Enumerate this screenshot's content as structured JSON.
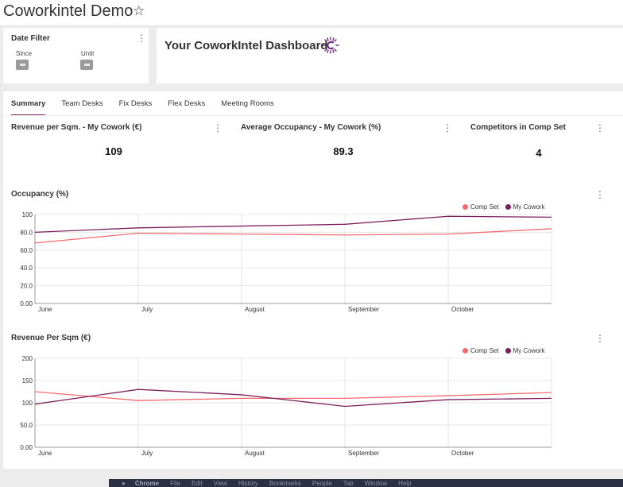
{
  "app": {
    "title": "Coworkintel Demo",
    "favorite_icon": "star-outline-icon"
  },
  "date_filter": {
    "title": "Date Filter",
    "since_label": "Since",
    "until_label": "Until"
  },
  "banner": {
    "title": "Your CoworkIntel Dashboard",
    "logo_icon": "coworkintel-logo-icon"
  },
  "tabs": [
    {
      "label": "Summary",
      "active": true
    },
    {
      "label": "Team Desks",
      "active": false
    },
    {
      "label": "Fix Desks",
      "active": false
    },
    {
      "label": "Flex Desks",
      "active": false
    },
    {
      "label": "Meeting Rooms",
      "active": false
    }
  ],
  "kpis": [
    {
      "title": "Revenue per Sqm. - My Cowork (€)",
      "value": "109"
    },
    {
      "title": "Average Occupancy - My Cowork (%)",
      "value": "89.3"
    },
    {
      "title": "Competitors in Comp Set",
      "value": "4"
    }
  ],
  "colors": {
    "comp_set": "#f36a6f",
    "my_cowork": "#7b1f5c",
    "accent": "#7b2d5c",
    "grid": "#e6e6e6"
  },
  "chart_data": [
    {
      "type": "line",
      "title": "Occupancy (%)",
      "categories": [
        "June",
        "July",
        "August",
        "September",
        "October"
      ],
      "x": [
        0,
        1,
        2,
        3,
        4,
        5
      ],
      "ylim": [
        0,
        100
      ],
      "yticks": [
        "0.00",
        "20.0",
        "40.0",
        "60.0",
        "80.0",
        "100"
      ],
      "legend_position": "top-right",
      "grid": true,
      "series": [
        {
          "name": "Comp Set",
          "values": [
            68,
            79,
            78,
            77,
            78,
            84
          ]
        },
        {
          "name": "My Cowork",
          "values": [
            80,
            85,
            87,
            89,
            98,
            97
          ]
        }
      ]
    },
    {
      "type": "line",
      "title": "Revenue Per Sqm (€)",
      "categories": [
        "June",
        "July",
        "August",
        "September",
        "October"
      ],
      "x": [
        0,
        1,
        2,
        3,
        4,
        5
      ],
      "ylim": [
        0,
        200
      ],
      "yticks": [
        "0.00",
        "50.0",
        "100",
        "150",
        "200"
      ],
      "legend_position": "top-right",
      "grid": true,
      "series": [
        {
          "name": "Comp Set",
          "values": [
            125,
            105,
            110,
            110,
            116,
            123
          ]
        },
        {
          "name": "My Cowork",
          "values": [
            97,
            130,
            118,
            92,
            107,
            110
          ]
        }
      ]
    }
  ],
  "taskbar": {
    "items": [
      "Chrome",
      "File",
      "Edit",
      "View",
      "History",
      "Bookmarks",
      "People",
      "Tab",
      "Window",
      "Help"
    ]
  }
}
